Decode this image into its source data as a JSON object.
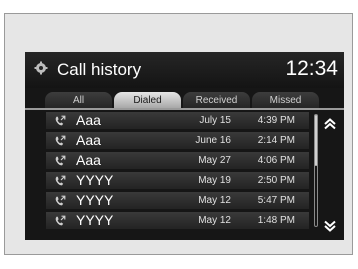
{
  "header": {
    "title": "Call history",
    "clock": "12:34",
    "icon": "settings-icon"
  },
  "tabs": [
    {
      "label": "All",
      "active": false
    },
    {
      "label": "Dialed",
      "active": true
    },
    {
      "label": "Received",
      "active": false
    },
    {
      "label": "Missed",
      "active": false
    }
  ],
  "calls": [
    {
      "name": "Aaa",
      "date": "July 15",
      "time": "4:39 PM",
      "icon": "dialed-call-icon"
    },
    {
      "name": "Aaa",
      "date": "June 16",
      "time": "2:14 PM",
      "icon": "dialed-call-icon"
    },
    {
      "name": "Aaa",
      "date": "May 27",
      "time": "4:06 PM",
      "icon": "dialed-call-icon"
    },
    {
      "name": "YYYY",
      "date": "May 19",
      "time": "2:50 PM",
      "icon": "dialed-call-icon"
    },
    {
      "name": "YYYY",
      "date": "May 12",
      "time": "5:47 PM",
      "icon": "dialed-call-icon"
    },
    {
      "name": "YYYY",
      "date": "May 12",
      "time": "1:48 PM",
      "icon": "dialed-call-icon"
    }
  ],
  "scroll": {
    "up_icon": "scroll-up-icon",
    "down_icon": "scroll-down-icon",
    "position": 0.0
  },
  "colors": {
    "screen_bg": "#161616",
    "active_tab": "#d8d8d8",
    "text": "#ffffff"
  }
}
